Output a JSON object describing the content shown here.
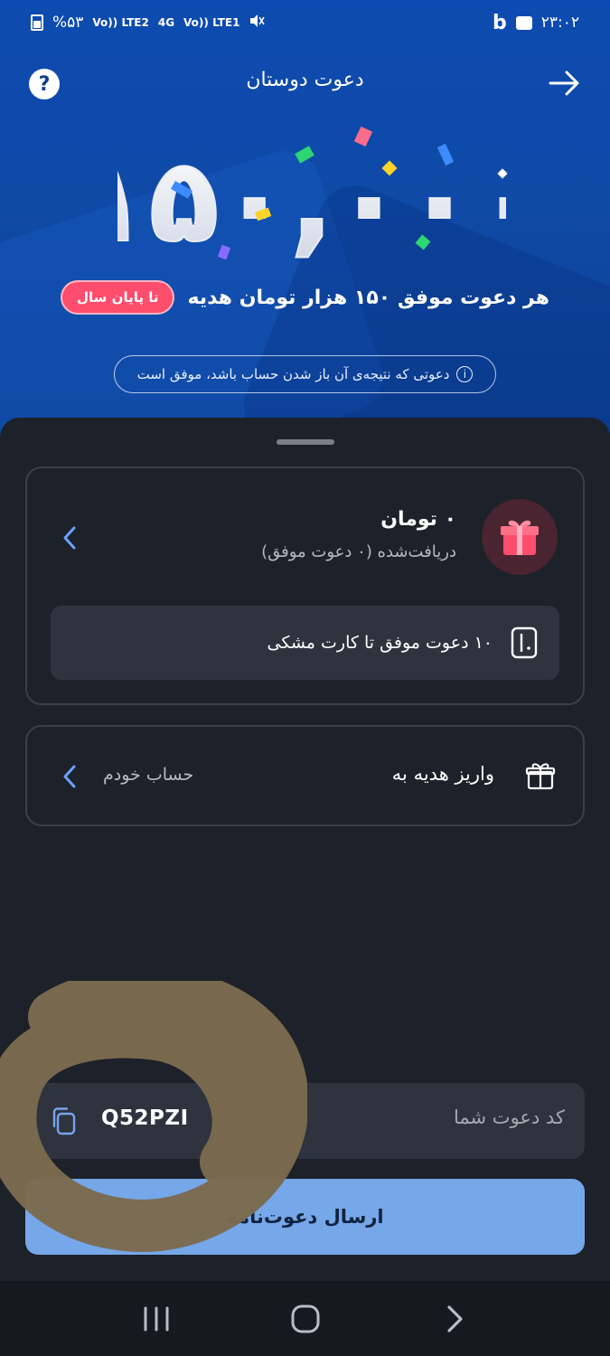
{
  "status_bar": {
    "battery": "%۵۳",
    "signal1": "Vo)) LTE2",
    "network": "4G",
    "signal2": "Vo)) LTE1",
    "brand": "b",
    "time": "۲۳:۰۲"
  },
  "header": {
    "title": "دعوت دوستان",
    "help_label": "?"
  },
  "hero": {
    "amount": "۱۵۰,۰۰۰",
    "tagline": "هر دعوت موفق ۱۵۰ هزار تومان هدیه",
    "badge": "تا پایان سال",
    "info": "دعوتی که نتیجه‌ی آن باز شدن حساب باشد، موفق است",
    "info_icon": "i"
  },
  "reward_card": {
    "amount": "۰ تومان",
    "subtitle": "دریافت‌شده (۰ دعوت موفق)",
    "progress_text": "۱۰ دعوت موفق تا کارت مشکی"
  },
  "deposit_card": {
    "label": "واریز هدیه به",
    "value": "حساب خودم"
  },
  "invite_code": {
    "label": "کد دعوت شما",
    "value": "Q52PZI"
  },
  "send_button": {
    "label": "ارسال دعوت‌نامه"
  },
  "colors": {
    "hero_blue": "#0f4aa6",
    "sheet_bg": "#1d2129",
    "button_blue": "#76a7e9",
    "badge_pink": "#ff4d6d",
    "scribble": "#7b6a4e"
  }
}
